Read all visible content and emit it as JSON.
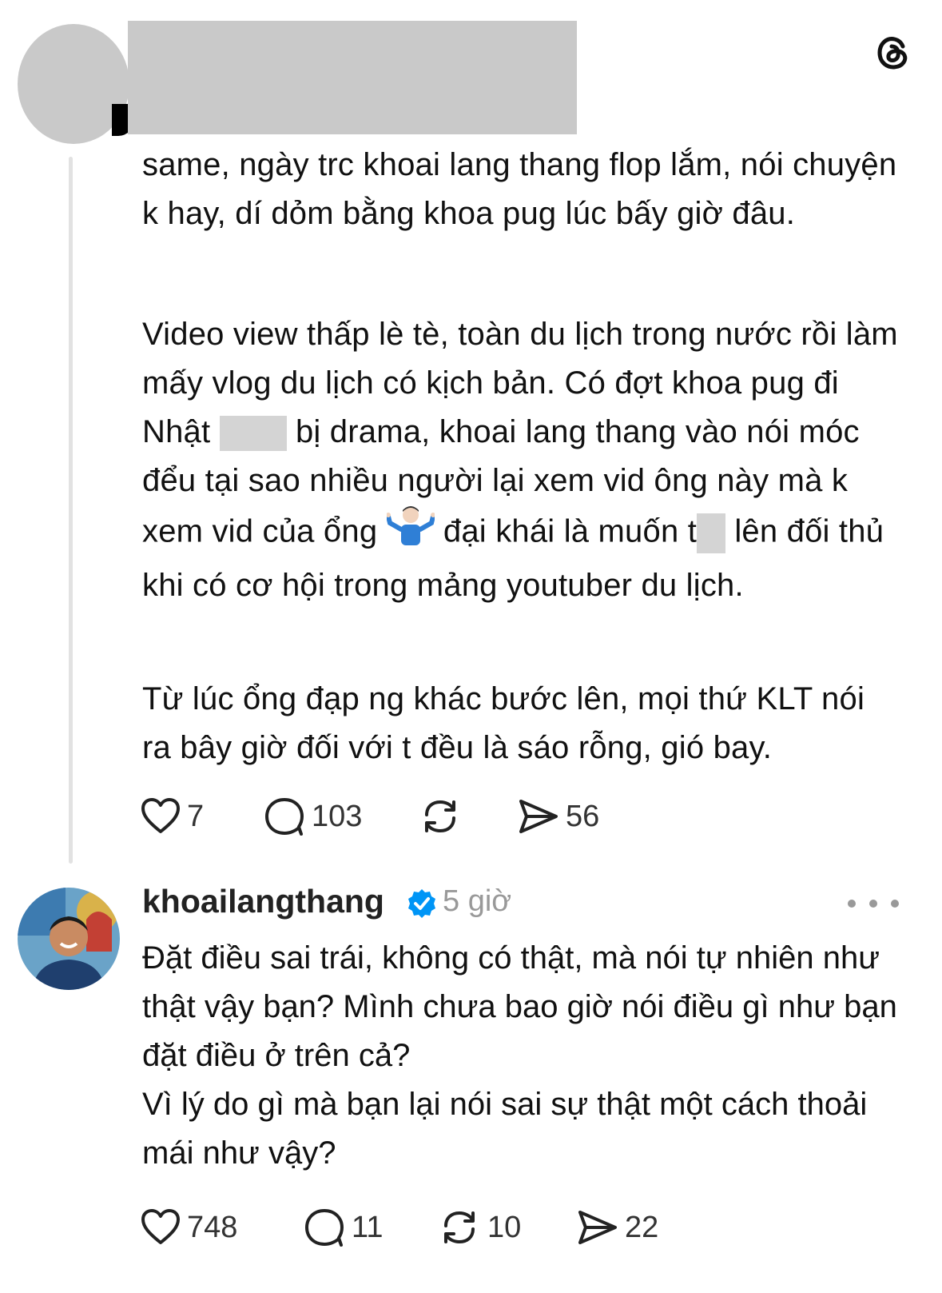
{
  "post1": {
    "paragraphs": [
      "same, ngày trc khoai lang thang flop lắm, nói chuyện k hay, dí dỏm bằng khoa pug lúc bấy giờ đâu.",
      "Từ lúc ổng đạp ng khác bước lên, mọi thứ KLT nói ra bây giờ đối với t đều là sáo rỗng, gió bay."
    ],
    "p2_parts": {
      "a": "Video view thấp lè tè, toàn du lịch trong nước rồi làm mấy vlog du lịch có kịch bản. Có đợt khoa pug đi Nhật",
      "b": " bị drama, khoai lang thang vào nói móc đểu tại sao nhiều người lại xem vid ông này mà k xem vid của ổng ",
      "c": " đại khái là muốn t",
      "d": " lên đối thủ khi có cơ hội trong mảng youtuber du lịch."
    },
    "stats": {
      "likes": "7",
      "comments": "103",
      "shares": "56"
    }
  },
  "post2": {
    "author": "khoailangthang",
    "time": "5 giờ",
    "lines": [
      "Đặt điều sai trái, không có thật, mà nói tự nhiên như thật vậy bạn? Mình chưa bao giờ nói điều gì như bạn đặt điều ở trên cả?",
      "Vì lý do gì mà bạn lại nói sai sự thật một cách thoải mái như vậy?"
    ],
    "stats": {
      "likes": "748",
      "comments": "11",
      "reposts": "10",
      "shares": "22"
    }
  },
  "icons": {
    "app_logo": "threads-logo-icon",
    "like": "heart-icon",
    "comment": "comment-bubble-icon",
    "repost": "repost-icon",
    "share": "send-icon",
    "verified": "verified-badge-icon",
    "more": "more-dots-icon",
    "emoji": "shrugging-person-emoji"
  },
  "colors": {
    "verified": "#0095f6",
    "redaction": "#c9c9c9",
    "muted": "#999999"
  }
}
